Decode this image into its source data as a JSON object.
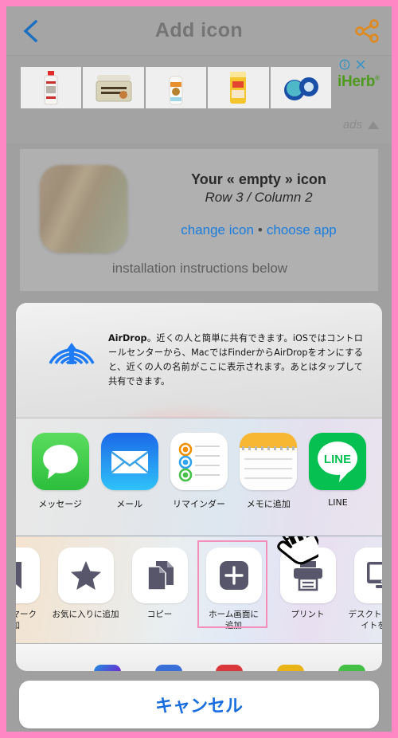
{
  "header": {
    "title": "Add icon",
    "back_icon": "chevron-left-icon",
    "share_icon": "share-nodes-icon",
    "back_color": "#1a6fc0",
    "share_color": "#e08a1e",
    "title_color": "#757575"
  },
  "ad": {
    "brand": "iHerb",
    "brand_mark": "®",
    "brand_color": "#4e9a1f",
    "label": "ads",
    "info_icon": "info-circle-icon",
    "close_icon": "close-x-icon",
    "collapse_icon": "triangle-up-icon",
    "products": [
      {
        "name": "sanitizer-bottle"
      },
      {
        "name": "clay-mask-jar"
      },
      {
        "name": "pet-shampoo-bottle"
      },
      {
        "name": "deodorant-stick"
      },
      {
        "name": "eye-patch-jars"
      }
    ]
  },
  "icon_card": {
    "title": "Your « empty » icon",
    "subtitle": "Row 3 / Column 2",
    "link_change": "change icon",
    "link_separator": "•",
    "link_choose": "choose app",
    "note": "installation instructions below",
    "link_color": "#1a7de0"
  },
  "share_sheet": {
    "airdrop": {
      "logo_icon": "airdrop-icon",
      "logo_color": "#1f7bf5",
      "title": "AirDrop",
      "body": "。近くの人と簡単に共有できます。iOSではコントロールセンターから、MacではFinderからAirDropをオンにすると、近くの人の名前がここに表示されます。あとはタップして共有できます。"
    },
    "apps": [
      {
        "label": "メッセージ",
        "icon": "messages-icon"
      },
      {
        "label": "メール",
        "icon": "mail-icon"
      },
      {
        "label": "リマインダー",
        "icon": "reminders-icon"
      },
      {
        "label": "メモに追加",
        "icon": "notes-icon"
      },
      {
        "label": "LINE",
        "icon": "line-icon"
      }
    ],
    "actions": [
      {
        "label": "ブックマーク\n追加",
        "icon": "bookmark-icon",
        "highlighted": false
      },
      {
        "label": "お気に入りに追加",
        "icon": "star-icon",
        "highlighted": false
      },
      {
        "label": "コピー",
        "icon": "copy-icon",
        "highlighted": false
      },
      {
        "label": "ホーム画面に\n追加",
        "icon": "add-plus-icon",
        "highlighted": true
      },
      {
        "label": "プリント",
        "icon": "printer-icon",
        "highlighted": false
      },
      {
        "label": "デスクトップ用サ\nイトを表示",
        "icon": "desktop-monitor-icon",
        "highlighted": false
      }
    ],
    "highlight_color": "#f48fbc",
    "cursor_icon": "hand-pointer-cursor"
  },
  "cancel": {
    "label": "キャンセル",
    "color": "#1a6ee0"
  },
  "frame": {
    "border_color": "#ff87c3",
    "edge_chevron_icon": "chevron-left-small-icon"
  }
}
